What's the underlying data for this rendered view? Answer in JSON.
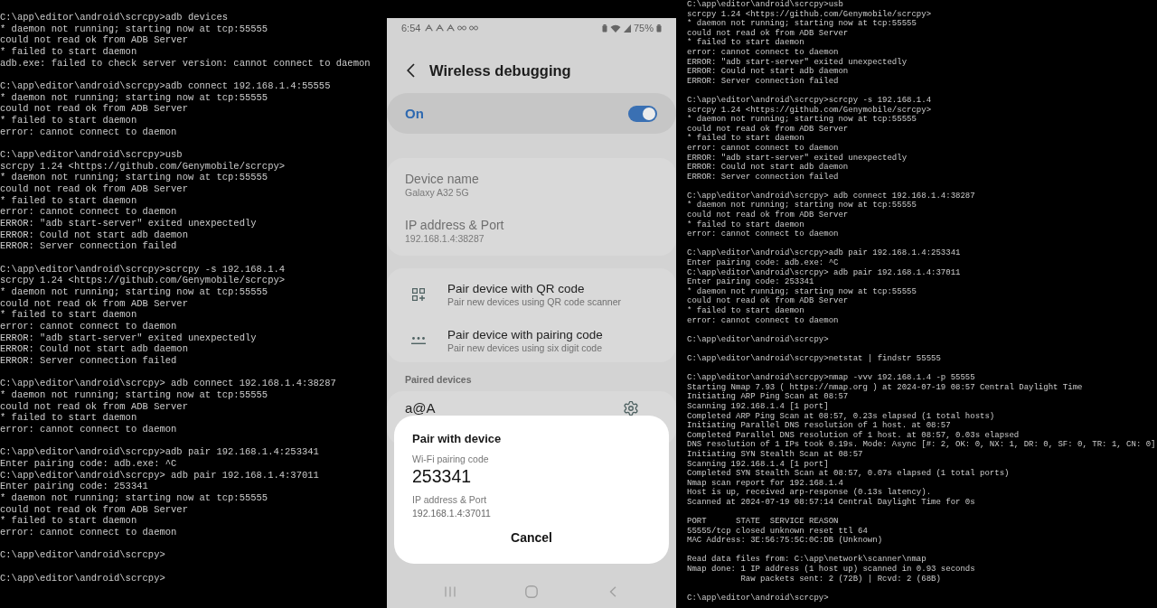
{
  "terminals": [
    {
      "blocks": [
        [
          "C:\\app\\editor\\android\\scrcpy>adb devices",
          "* daemon not running; starting now at tcp:55555",
          "could not read ok from ADB Server",
          "* failed to start daemon",
          "adb.exe: failed to check server version: cannot connect to daemon"
        ],
        [
          "C:\\app\\editor\\android\\scrcpy>adb connect 192.168.1.4:55555",
          "* daemon not running; starting now at tcp:55555",
          "could not read ok from ADB Server",
          "* failed to start daemon",
          "error: cannot connect to daemon"
        ],
        [
          "C:\\app\\editor\\android\\scrcpy>usb",
          "scrcpy 1.24 <https://github.com/Genymobile/scrcpy>",
          "* daemon not running; starting now at tcp:55555",
          "could not read ok from ADB Server",
          "* failed to start daemon",
          "error: cannot connect to daemon",
          "ERROR: \"adb start-server\" exited unexpectedly",
          "ERROR: Could not start adb daemon",
          "ERROR: Server connection failed"
        ],
        [
          "C:\\app\\editor\\android\\scrcpy>scrcpy -s 192.168.1.4",
          "scrcpy 1.24 <https://github.com/Genymobile/scrcpy>",
          "* daemon not running; starting now at tcp:55555",
          "could not read ok from ADB Server",
          "* failed to start daemon",
          "error: cannot connect to daemon",
          "ERROR: \"adb start-server\" exited unexpectedly",
          "ERROR: Could not start adb daemon",
          "ERROR: Server connection failed"
        ],
        [
          "C:\\app\\editor\\android\\scrcpy> adb connect 192.168.1.4:38287",
          "* daemon not running; starting now at tcp:55555",
          "could not read ok from ADB Server",
          "* failed to start daemon",
          "error: cannot connect to daemon"
        ],
        [
          "C:\\app\\editor\\android\\scrcpy>adb pair 192.168.1.4:253341",
          "Enter pairing code: adb.exe: ^C",
          "C:\\app\\editor\\android\\scrcpy> adb pair 192.168.1.4:37011",
          "Enter pairing code: 253341",
          "* daemon not running; starting now at tcp:55555",
          "could not read ok from ADB Server",
          "* failed to start daemon",
          "error: cannot connect to daemon"
        ],
        [
          "C:\\app\\editor\\android\\scrcpy>"
        ],
        [
          "C:\\app\\editor\\android\\scrcpy>"
        ]
      ]
    },
    {
      "blocks": [
        [
          "C:\\app\\editor\\android\\scrcpy>usb",
          "scrcpy 1.24 <https://github.com/Genymobile/scrcpy>",
          "* daemon not running; starting now at tcp:55555",
          "could not read ok from ADB Server",
          "* failed to start daemon",
          "error: cannot connect to daemon",
          "ERROR: \"adb start-server\" exited unexpectedly",
          "ERROR: Could not start adb daemon",
          "ERROR: Server connection failed"
        ],
        [
          "C:\\app\\editor\\android\\scrcpy>scrcpy -s 192.168.1.4",
          "scrcpy 1.24 <https://github.com/Genymobile/scrcpy>",
          "* daemon not running; starting now at tcp:55555",
          "could not read ok from ADB Server",
          "* failed to start daemon",
          "error: cannot connect to daemon",
          "ERROR: \"adb start-server\" exited unexpectedly",
          "ERROR: Could not start adb daemon",
          "ERROR: Server connection failed"
        ],
        [
          "C:\\app\\editor\\android\\scrcpy> adb connect 192.168.1.4:38287",
          "* daemon not running; starting now at tcp:55555",
          "could not read ok from ADB Server",
          "* failed to start daemon",
          "error: cannot connect to daemon"
        ],
        [
          "C:\\app\\editor\\android\\scrcpy>adb pair 192.168.1.4:253341",
          "Enter pairing code: adb.exe: ^C",
          "C:\\app\\editor\\android\\scrcpy> adb pair 192.168.1.4:37011",
          "Enter pairing code: 253341",
          "* daemon not running; starting now at tcp:55555",
          "could not read ok from ADB Server",
          "* failed to start daemon",
          "error: cannot connect to daemon"
        ],
        [
          "C:\\app\\editor\\android\\scrcpy>"
        ],
        [
          "C:\\app\\editor\\android\\scrcpy>netstat | findstr 55555"
        ],
        [
          "C:\\app\\editor\\android\\scrcpy>nmap -vvv 192.168.1.4 -p 55555",
          "Starting Nmap 7.93 ( https://nmap.org ) at 2024-07-19 08:57 Central Daylight Time",
          "Initiating ARP Ping Scan at 08:57",
          "Scanning 192.168.1.4 [1 port]",
          "Completed ARP Ping Scan at 08:57, 0.23s elapsed (1 total hosts)",
          "Initiating Parallel DNS resolution of 1 host. at 08:57",
          "Completed Parallel DNS resolution of 1 host. at 08:57, 0.03s elapsed",
          "DNS resolution of 1 IPs took 0.19s. Mode: Async [#: 2, OK: 0, NX: 1, DR: 0, SF: 0, TR: 1, CN: 0]",
          "Initiating SYN Stealth Scan at 08:57",
          "Scanning 192.168.1.4 [1 port]",
          "Completed SYN Stealth Scan at 08:57, 0.07s elapsed (1 total ports)",
          "Nmap scan report for 192.168.1.4",
          "Host is up, received arp-response (0.13s latency).",
          "Scanned at 2024-07-19 08:57:14 Central Daylight Time for 0s"
        ],
        [
          "PORT      STATE  SERVICE REASON",
          "55555/tcp closed unknown reset ttl 64",
          "MAC Address: 3E:56:75:5C:0C:DB (Unknown)"
        ],
        [
          "Read data files from: C:\\app\\network\\scanner\\nmap",
          "Nmap done: 1 IP address (1 host up) scanned in 0.93 seconds",
          "           Raw packets sent: 2 (72B) | Rcvd: 2 (68B)"
        ],
        [
          "C:\\app\\editor\\android\\scrcpy>"
        ]
      ]
    }
  ],
  "phone": {
    "status_bar": {
      "time": "6:54",
      "battery": "75%"
    },
    "header": {
      "title": "Wireless debugging"
    },
    "master_switch": {
      "label": "On",
      "on": true
    },
    "device_info": [
      {
        "label": "Device name",
        "value": "Galaxy A32 5G"
      },
      {
        "label": "IP address & Port",
        "value": "192.168.1.4:38287"
      }
    ],
    "pairing_options": [
      {
        "kind": "qr",
        "title": "Pair device with QR code",
        "subtitle": "Pair new devices using QR code scanner"
      },
      {
        "kind": "code",
        "title": "Pair device with pairing code",
        "subtitle": "Pair new devices using six digit code"
      }
    ],
    "paired_devices": {
      "heading": "Paired devices",
      "items": [
        {
          "name": "a@A"
        }
      ]
    },
    "dialog": {
      "title": "Pair with device",
      "code_label": "Wi-Fi pairing code",
      "code": "253341",
      "address_label": "IP address & Port",
      "address": "192.168.1.4:37011",
      "button": "Cancel"
    }
  }
}
